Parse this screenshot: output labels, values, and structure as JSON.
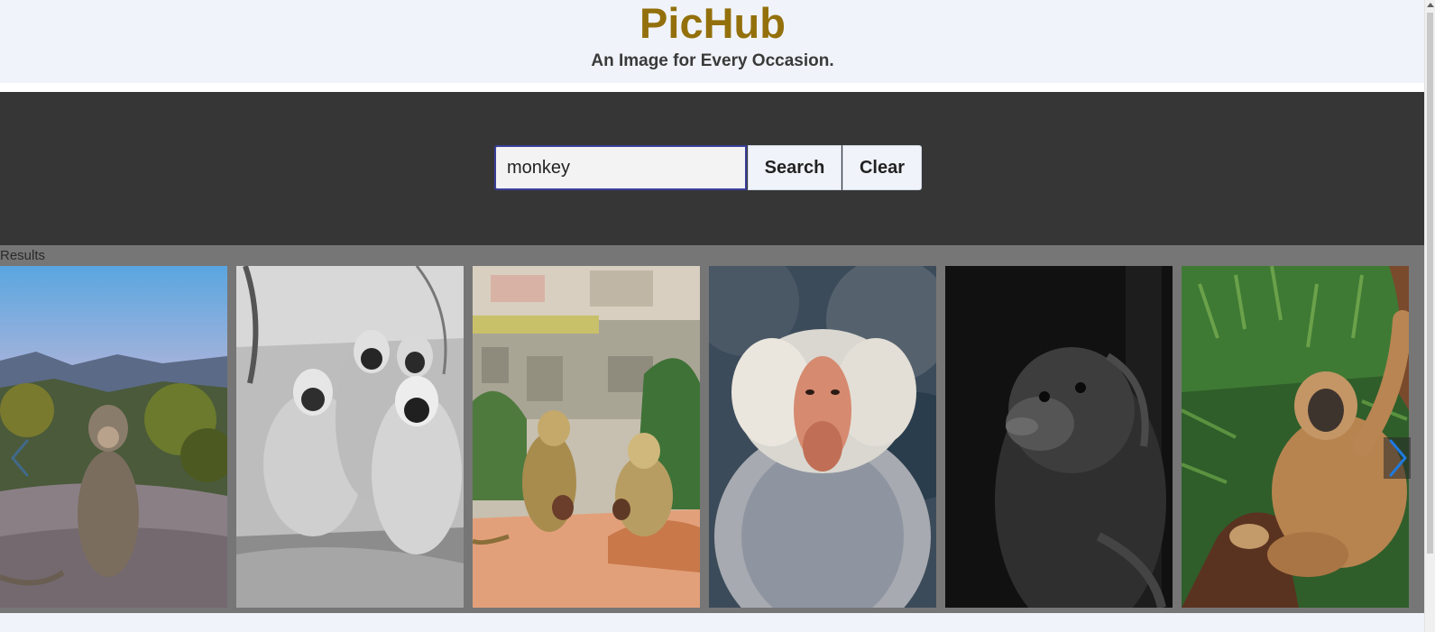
{
  "header": {
    "brand": "PicHub",
    "tagline": "An Image for Every Occasion."
  },
  "search": {
    "value": "monkey",
    "search_label": "Search",
    "clear_label": "Clear"
  },
  "results": {
    "label": "Results",
    "items": [
      {
        "subject": "macaque sitting on rock at sunset",
        "palette": "color"
      },
      {
        "subject": "group of langurs in black and white",
        "palette": "grayscale"
      },
      {
        "subject": "langurs with babies on rooftop",
        "palette": "color"
      },
      {
        "subject": "hamadryas baboon portrait",
        "palette": "color"
      },
      {
        "subject": "black monkey looking up",
        "palette": "grayscale"
      },
      {
        "subject": "gibbon on tree branch",
        "palette": "color"
      }
    ]
  },
  "icons": {
    "prev": "chevron-left-icon",
    "next": "chevron-right-icon"
  },
  "colors": {
    "brand": "#93700b",
    "search_band": "#363636",
    "results_band": "#767676",
    "header_bg": "#f0f3f9"
  }
}
